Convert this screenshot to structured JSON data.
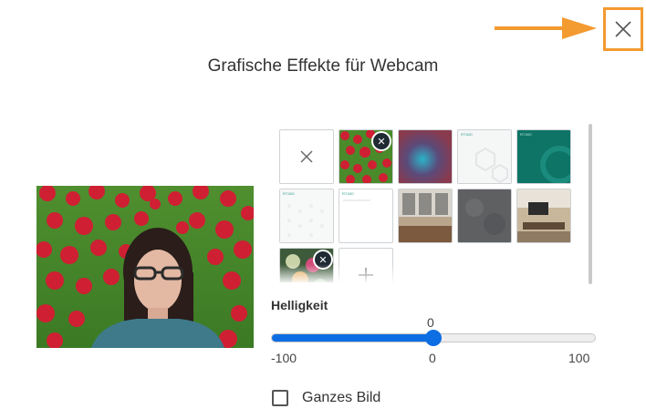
{
  "dialog": {
    "title": "Grafische Effekte für Webcam",
    "close_icon": "close-icon",
    "arrow_color": "#f39a31"
  },
  "preview": {
    "icon": "webcam-preview"
  },
  "backgrounds": {
    "tiles": [
      {
        "kind": "none",
        "icon": "no-effect-icon"
      },
      {
        "kind": "flowers",
        "removable": true
      },
      {
        "kind": "bokeh"
      },
      {
        "kind": "light-pattern",
        "label": "RT.000"
      },
      {
        "kind": "teal",
        "label": "RT.000"
      },
      {
        "kind": "light-dots",
        "label": "RT.000"
      },
      {
        "kind": "light-text",
        "label": "RT.000"
      },
      {
        "kind": "office"
      },
      {
        "kind": "concrete"
      },
      {
        "kind": "meeting-room"
      },
      {
        "kind": "flowers-dark",
        "removable": true
      },
      {
        "kind": "add",
        "icon": "plus-icon"
      }
    ]
  },
  "brightness": {
    "label": "Helligkeit",
    "value": "0",
    "value_fraction": 0.5,
    "min_label": "-100",
    "mid_label": "0",
    "max_label": "100",
    "accent": "#0d6ee3"
  },
  "fullimage": {
    "label": "Ganzes Bild",
    "checked": false
  }
}
